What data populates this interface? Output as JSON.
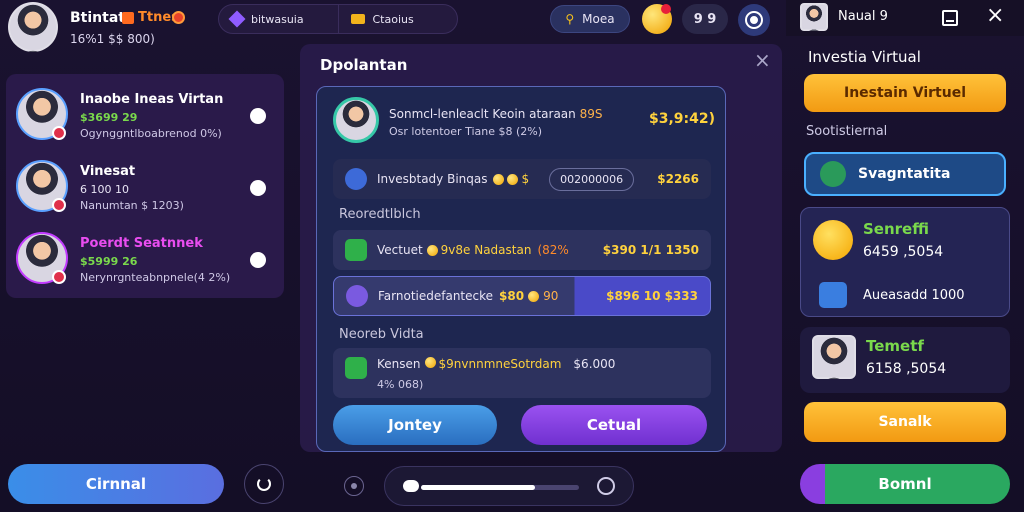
{
  "header": {
    "user_name": "Btintat",
    "user_tag": "Ttnes",
    "user_balance": "16%1 $$ 800)",
    "pill_left_label": "bitwasuia",
    "pill_right_label": "Ctaoius",
    "mode_label": "Moea",
    "count_value": "9 9"
  },
  "right_header": {
    "title": "Naual 9"
  },
  "left_players": [
    {
      "name": "Inaobe Ineas Virtan",
      "amount": "$3699 29",
      "detail": "Ogynggntlboabrenod 0%)"
    },
    {
      "name": "Vinesat",
      "amount": "6 100 10",
      "detail": "Nanumtan $ 1203)"
    },
    {
      "name": "Poerdt Seatnnek",
      "amount": "$5999 26",
      "detail": "Nerynrgnteabnpnele(4 2%)"
    }
  ],
  "modal": {
    "title": "Dpolantan",
    "header_line1": "Sonmcl-lenleaclt Keoin ataraan",
    "header_line1_extra": "89S",
    "header_line2": "Osr lotentoer Tiane $8 (2%)",
    "header_amount": "$3,9:42)",
    "invest_label": "Invesbtady Binqas",
    "invest_coins": "$",
    "invest_input": "002000006",
    "invest_amount": "$2266",
    "section1": "Reoredtlblch",
    "row1_label": "Vectuet",
    "row1_mid": "9v8e Nadastan",
    "row1_pct": "(82%",
    "row1_amount": "$390 1/1 1350",
    "row2_label": "Farnotiedefantecke",
    "row2_mid": "$80",
    "row2_extra": "90",
    "row2_amount": "$896 10 $333",
    "section2": "Neoreb Vidta",
    "row3_label": "Kensen",
    "row3_mid": "$9nvnnmneSotrdam",
    "row3_amount": "$6.000",
    "row3_sub": "4% 068)",
    "btn_left": "Jontey",
    "btn_right": "Cetual"
  },
  "right_panel": {
    "section_title": "Investia Virtual",
    "top_button": "Inestain Virtuel",
    "subtitle": "Sootistiernal",
    "selected_option": "Svagntatita",
    "card1_name": "Senreffi",
    "card1_amount": "6459 ,5054",
    "card1_sub": "Aueasadd 1000",
    "card2_name": "Temetf",
    "card2_amount": "6158 ,5054",
    "orange_button": "Sanalk",
    "bottom_button": "Bomnl"
  },
  "bottom": {
    "left_button": "Cirnnal"
  },
  "colors": {
    "accent_orange": "#f7a21b",
    "accent_purple": "#8a3ee0",
    "accent_blue": "#3b8ee0",
    "money_yellow": "#ffd23d",
    "money_green": "#7ad94c"
  },
  "slider": {
    "value": 0.72
  }
}
